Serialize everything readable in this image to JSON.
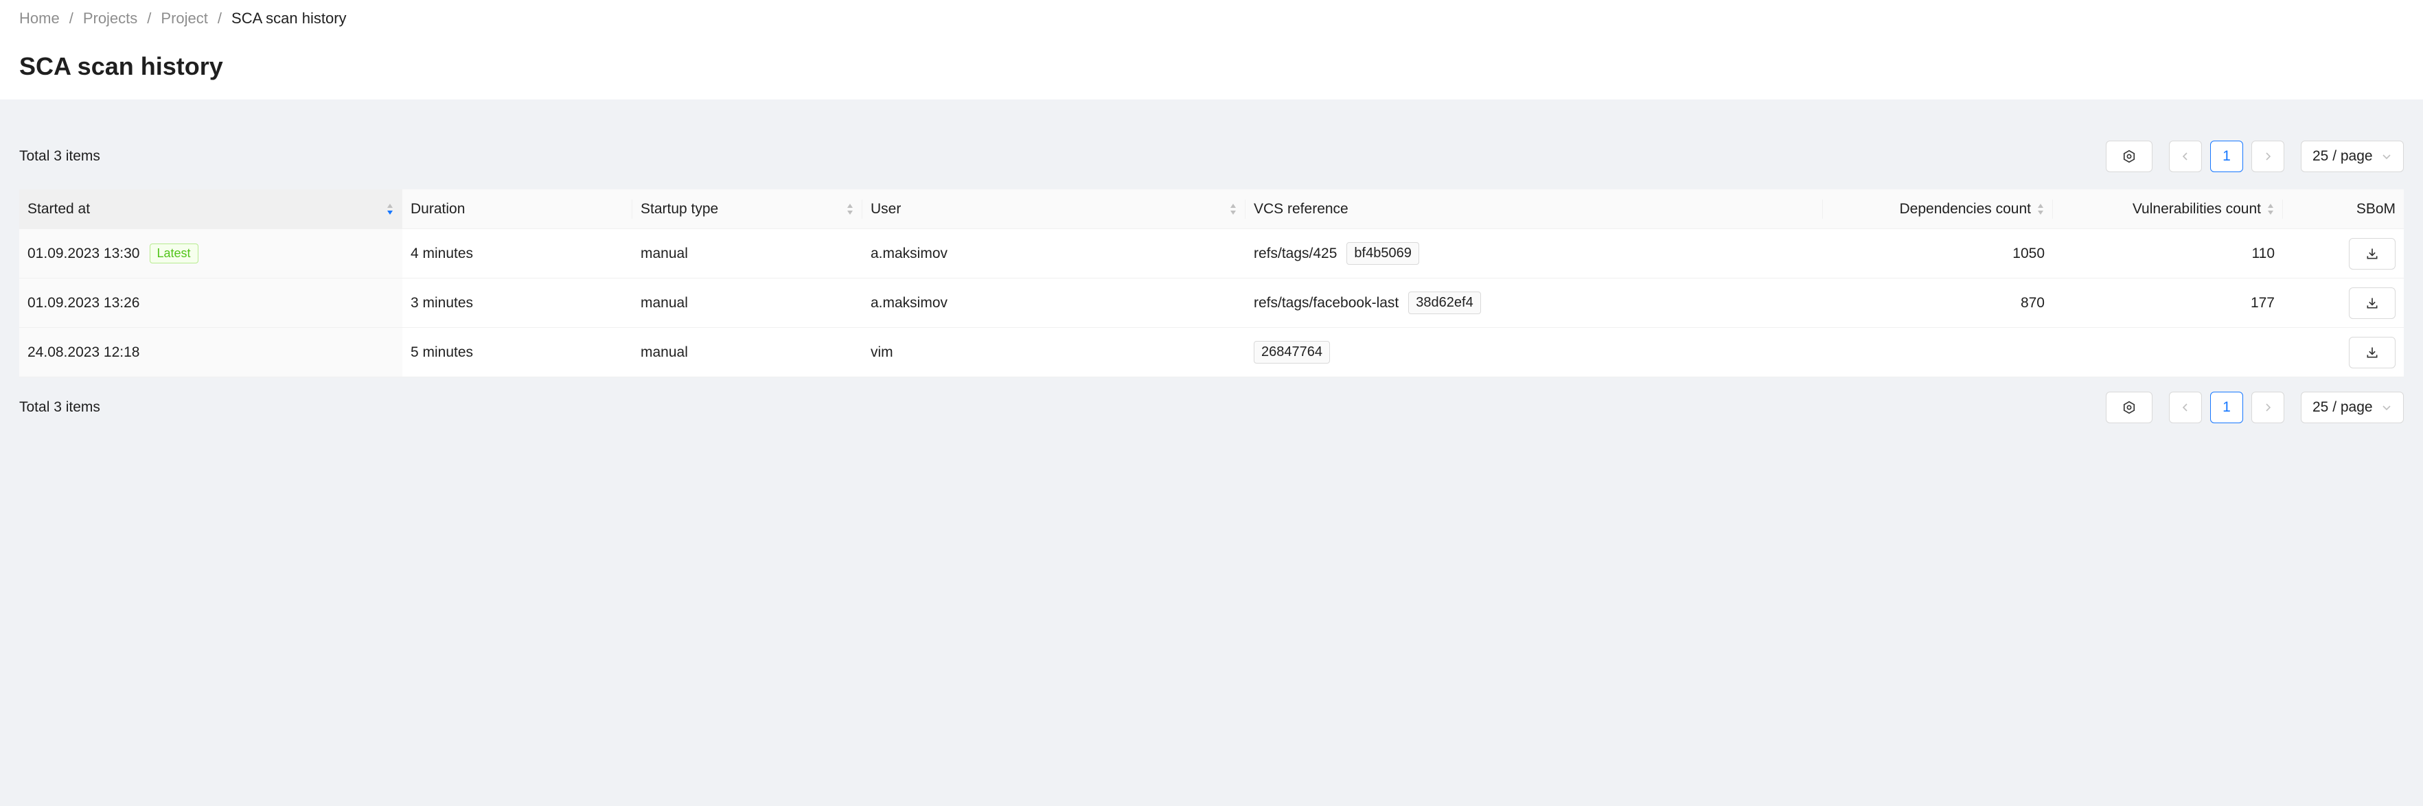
{
  "breadcrumb": [
    {
      "label": "Home"
    },
    {
      "label": "Projects"
    },
    {
      "label": "Project"
    },
    {
      "label": "SCA scan history"
    }
  ],
  "page": {
    "title": "SCA scan history"
  },
  "toolbar": {
    "total_label": "Total 3 items",
    "current_page": "1",
    "page_size": "25 / page"
  },
  "columns": {
    "started_at": "Started at",
    "duration": "Duration",
    "startup_type": "Startup type",
    "user": "User",
    "vcs_reference": "VCS reference",
    "dependencies_count": "Dependencies count",
    "vulnerabilities_count": "Vulnerabilities count",
    "sbom": "SBoM"
  },
  "rows": [
    {
      "started_at": "01.09.2023 13:30",
      "badge": "Latest",
      "duration": "4 minutes",
      "startup_type": "manual",
      "user": "a.maksimov",
      "vcs_ref": "refs/tags/425",
      "commit": "bf4b5069",
      "dependencies": "1050",
      "vulnerabilities": "110"
    },
    {
      "started_at": "01.09.2023 13:26",
      "duration": "3 minutes",
      "startup_type": "manual",
      "user": "a.maksimov",
      "vcs_ref": "refs/tags/facebook-last",
      "commit": "38d62ef4",
      "dependencies": "870",
      "vulnerabilities": "177"
    },
    {
      "started_at": "24.08.2023 12:18",
      "duration": "5 minutes",
      "startup_type": "manual",
      "user": "vim",
      "vcs_ref": "",
      "commit": "26847764",
      "dependencies": "",
      "vulnerabilities": ""
    }
  ],
  "icons": {
    "settings": "gear-icon",
    "prev": "chevron-left-icon",
    "next": "chevron-right-icon",
    "dropdown": "chevron-down-icon",
    "download": "download-icon",
    "sort": "sort-icon"
  },
  "colors": {
    "accent": "#1677ff",
    "success": "#52c41a",
    "background": "#f0f2f5"
  }
}
